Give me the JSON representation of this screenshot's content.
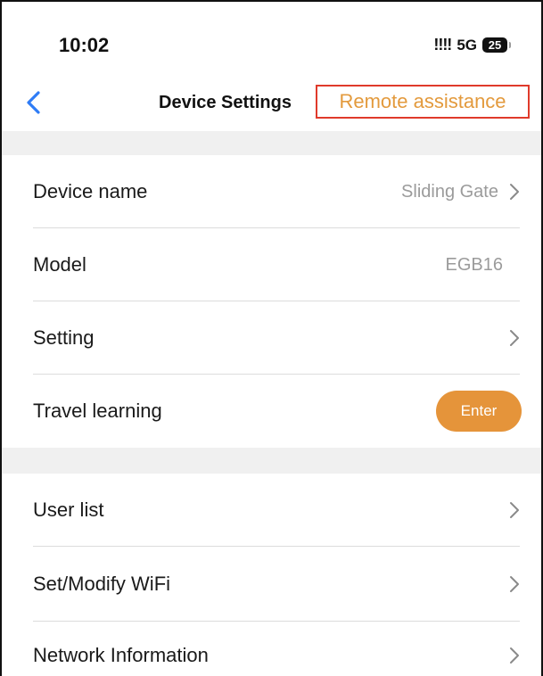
{
  "status_bar": {
    "time": "10:02",
    "signal": "!!!!",
    "network": "5G",
    "battery": "25"
  },
  "nav": {
    "back_icon": "chevron-left-icon",
    "title": "Device Settings",
    "remote_assistance": "Remote assistance"
  },
  "colors": {
    "accent": "#e5943a",
    "highlight_border": "#e03a2b",
    "back_arrow": "#2f7cf6",
    "section_gap": "#f0f0f0"
  },
  "section1": {
    "device_name": {
      "label": "Device name",
      "value": "Sliding Gate"
    },
    "model": {
      "label": "Model",
      "value": "EGB16"
    },
    "setting": {
      "label": "Setting"
    },
    "travel_learning": {
      "label": "Travel learning",
      "button": "Enter"
    }
  },
  "section2": {
    "user_list": {
      "label": "User list"
    },
    "wifi": {
      "label": "Set/Modify WiFi"
    },
    "network_info": {
      "label": "Network Information"
    }
  }
}
